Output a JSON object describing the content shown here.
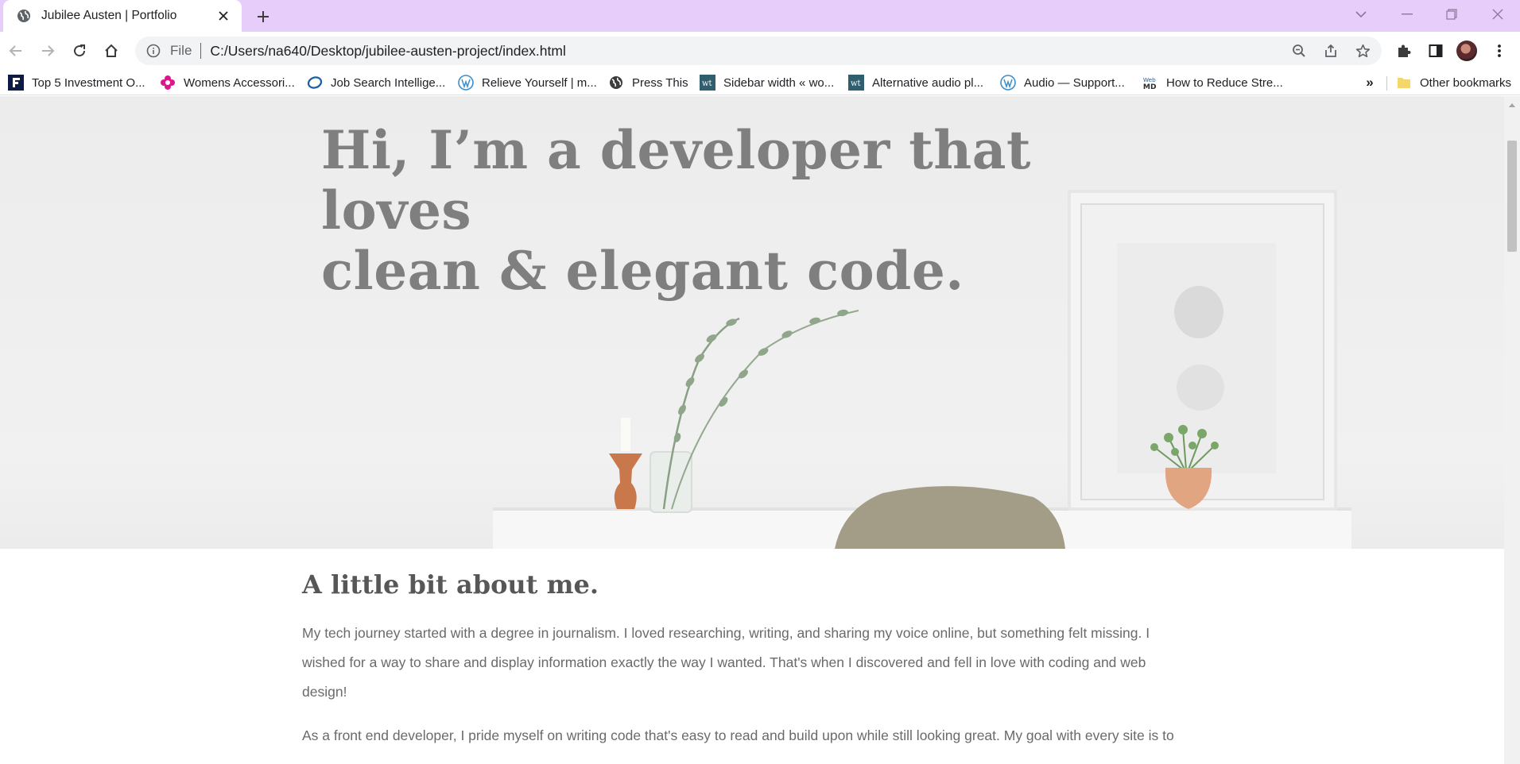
{
  "browser": {
    "tab_title": "Jubilee Austen | Portfolio",
    "omnibox_scheme": "File",
    "url": "C:/Users/na640/Desktop/jubilee-austen-project/index.html",
    "accent_color": "#e6cdfa"
  },
  "bookmarks": [
    {
      "label": "Top 5 Investment O...",
      "icon": "forbes-f-icon"
    },
    {
      "label": "Womens Accessori...",
      "icon": "flower-icon"
    },
    {
      "label": "Job Search Intellige...",
      "icon": "swirl-icon"
    },
    {
      "label": "Relieve Yourself | m...",
      "icon": "wordpress-icon"
    },
    {
      "label": "Press This",
      "icon": "globe-icon"
    },
    {
      "label": "Sidebar width « wo...",
      "icon": "wt-icon"
    },
    {
      "label": "Alternative audio pl...",
      "icon": "wt-icon"
    },
    {
      "label": "Audio — Support...",
      "icon": "wordpress-icon"
    },
    {
      "label": "How to Reduce Stre...",
      "icon": "webmd-icon"
    }
  ],
  "bookmarks_more": "»",
  "other_bookmarks": "Other bookmarks",
  "hero": {
    "line1": "Hi, I’m a developer that loves",
    "line2": "clean & elegant code."
  },
  "about": {
    "title": "A little bit about me.",
    "p1": "My tech journey started with a degree in journalism. I loved researching, writing, and sharing my voice online, but something felt missing. I wished for a way to share and display information exactly the way I wanted. That's when I discovered and fell in love with coding and web design!",
    "p2": "As a front end developer, I pride myself on writing code that's easy to read and build upon while still looking great. My goal with every site is to"
  }
}
